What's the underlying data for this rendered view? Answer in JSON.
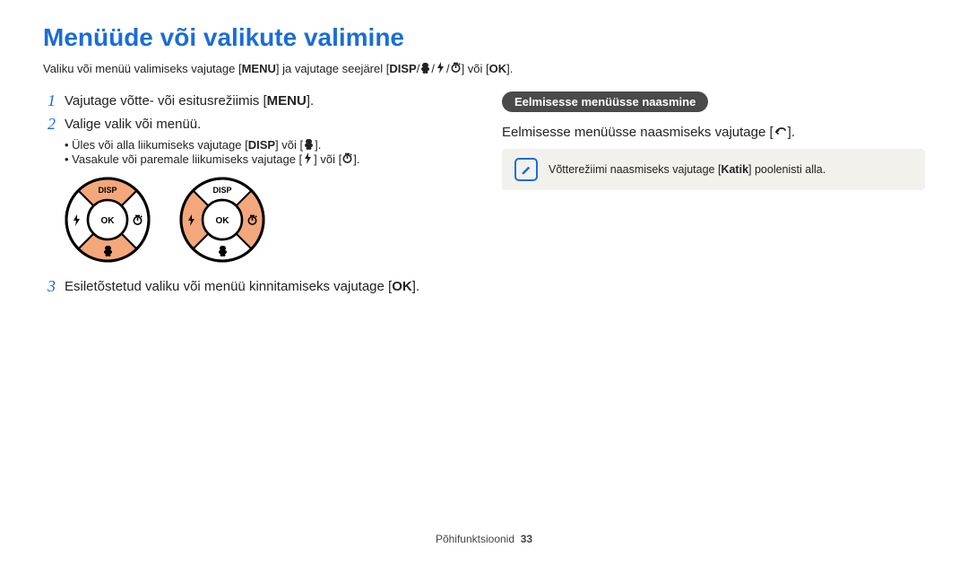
{
  "title": "Menüüde või valikute valimine",
  "intro": {
    "part1": "Valiku või menüü valimiseks vajutage [",
    "menu": "MENU",
    "part2": "] ja vajutage seejärel [",
    "disp": "DISP",
    "sep1": "/",
    "sep2": "/",
    "sep3": "/",
    "part3": "] või [",
    "ok": "OK",
    "part4": "]."
  },
  "steps": {
    "s1": {
      "num": "1",
      "t1": "Vajutage võtte- või esitusrežiimis [",
      "menu": "MENU",
      "t2": "]."
    },
    "s2": {
      "num": "2",
      "text": "Valige valik või menüü.",
      "b1a": "Üles või alla liikumiseks vajutage [",
      "b1_disp": "DISP",
      "b1b": "] või [",
      "b1c": "].",
      "b2a": "Vasakule või paremale liikumiseks vajutage [",
      "b2b": "] või [",
      "b2c": "]."
    },
    "s3": {
      "num": "3",
      "t1": "Esiletõstetud valiku või menüü kinnitamiseks vajutage [",
      "ok": "OK",
      "t2": "]."
    }
  },
  "dial": {
    "disp": "DISP",
    "ok": "OK"
  },
  "right": {
    "pill": "Eelmisesse menüüsse naasmine",
    "p1a": "Eelmisesse menüüsse naasmiseks vajutage [",
    "p1b": "].",
    "note_a": "Võtterežiimi naasmiseks vajutage [",
    "note_b": "Katik",
    "note_c": "] poolenisti alla."
  },
  "footer": {
    "section": "Põhifunktsioonid",
    "page": "33"
  }
}
